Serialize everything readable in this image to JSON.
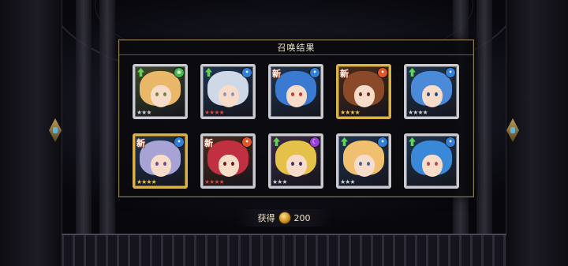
{
  "panel": {
    "title": "召唤结果"
  },
  "reward": {
    "label": "获得",
    "amount": "200",
    "currency_icon": "gold-coin-icon"
  },
  "colors": {
    "frame_silver": "#c9cad4",
    "frame_gold": "#d9b24a",
    "element_wind": "#3fb54a",
    "element_water": "#2f7fd8",
    "element_fire": "#e0552a",
    "element_dark": "#9a3fd6",
    "star_silver": "#cfd3dc",
    "star_gold": "#f2c23a",
    "star_red": "#e0453a"
  },
  "cards": [
    {
      "badge": "up",
      "element": "wind",
      "frame": "silver",
      "stars": 3,
      "star_color": "silver",
      "hair": "#e9b768",
      "eyes": "#6a8a3a"
    },
    {
      "badge": "up",
      "element": "water",
      "frame": "silver",
      "stars": 4,
      "star_color": "red",
      "hair": "#cfd8e6",
      "eyes": "#8a9ab8"
    },
    {
      "badge": "new",
      "element": "water",
      "frame": "silver",
      "stars": 0,
      "star_color": "silver",
      "hair": "#3a7ad0",
      "eyes": "#c03a3a"
    },
    {
      "badge": "new",
      "element": "fire",
      "frame": "gold",
      "stars": 4,
      "star_color": "gold",
      "hair": "#8a4a2a",
      "eyes": "#6a2a1a"
    },
    {
      "badge": "up",
      "element": "water",
      "frame": "silver",
      "stars": 4,
      "star_color": "silver",
      "hair": "#4a8ad8",
      "eyes": "#2a4a8a"
    },
    {
      "badge": "new",
      "element": "water",
      "frame": "gold",
      "stars": 4,
      "star_color": "gold",
      "hair": "#a7a3d4",
      "eyes": "#6a4a9a"
    },
    {
      "badge": "new",
      "element": "fire",
      "frame": "silver",
      "stars": 4,
      "star_color": "red",
      "hair": "#c03040",
      "eyes": "#6a1a1a"
    },
    {
      "badge": "up",
      "element": "dark",
      "frame": "silver",
      "stars": 3,
      "star_color": "silver",
      "hair": "#e4c24a",
      "eyes": "#4a2a6a"
    },
    {
      "badge": "up",
      "element": "water",
      "frame": "silver",
      "stars": 3,
      "star_color": "silver",
      "hair": "#f0c070",
      "eyes": "#3a6aa0"
    },
    {
      "badge": "up",
      "element": "water",
      "frame": "silver",
      "stars": 0,
      "star_color": "silver",
      "hair": "#3a88d8",
      "eyes": "#c04a4a"
    }
  ]
}
